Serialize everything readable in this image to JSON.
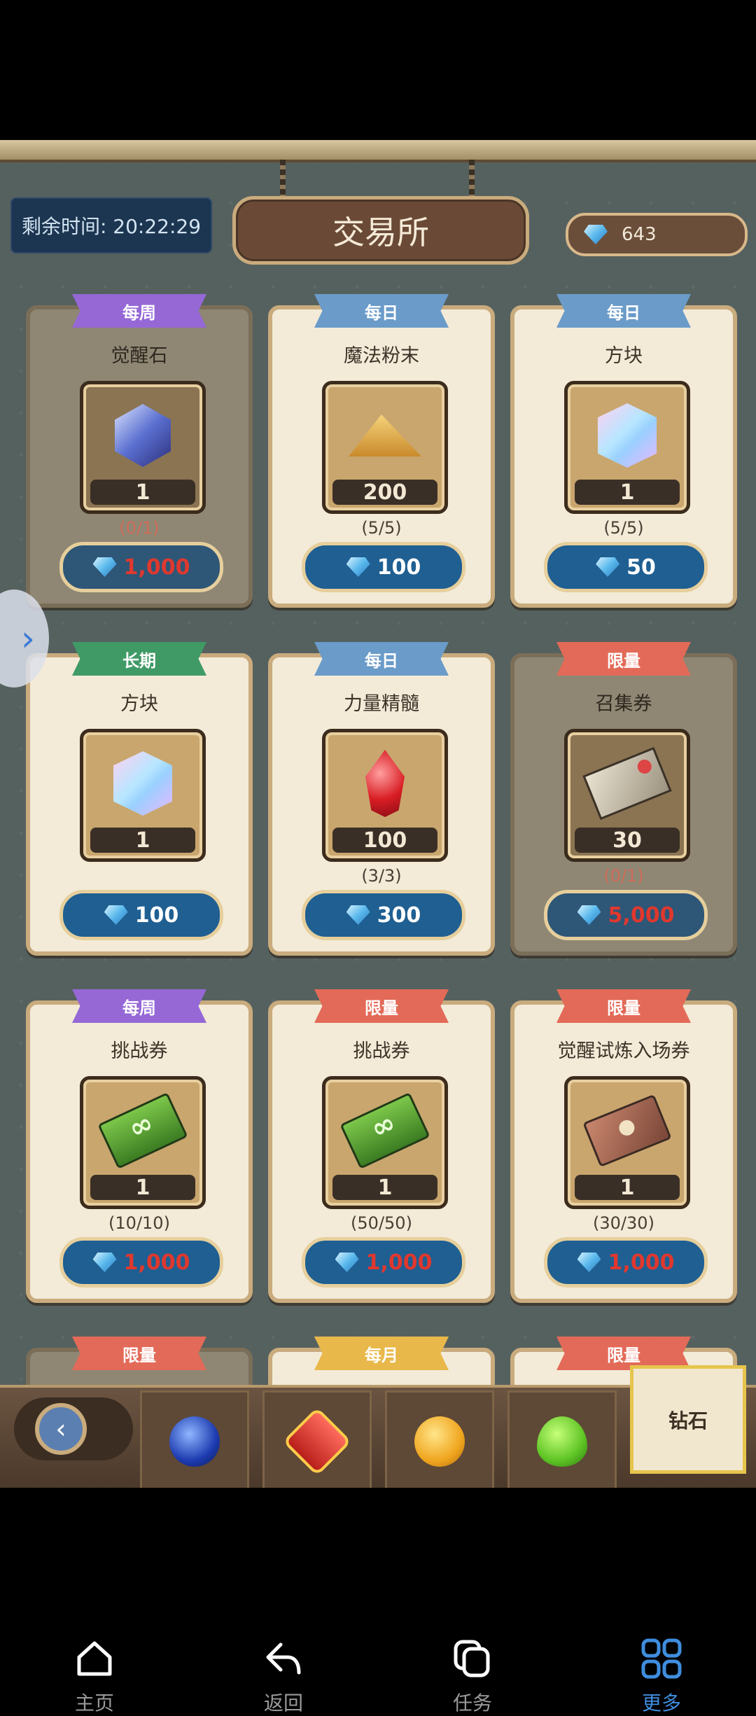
{
  "header": {
    "timer": "剩余时间: 20:22:29",
    "title": "交易所",
    "currency_value": "643"
  },
  "cards": [
    {
      "tag": "每周",
      "tag_color": "#9568d6",
      "name": "觉醒石",
      "icon": "crystal-icon",
      "qty": "1",
      "limit": "(0/1)",
      "price": "1,000",
      "price_red": true,
      "dim": true
    },
    {
      "tag": "每日",
      "tag_color": "#6a9bc9",
      "name": "魔法粉末",
      "icon": "powder-icon",
      "qty": "200",
      "limit": "(5/5)",
      "price": "100",
      "price_red": false,
      "dim": false
    },
    {
      "tag": "每日",
      "tag_color": "#6a9bc9",
      "name": "方块",
      "icon": "cube-icon",
      "qty": "1",
      "limit": "(5/5)",
      "price": "50",
      "price_red": false,
      "dim": false
    },
    {
      "tag": "长期",
      "tag_color": "#3f9a66",
      "name": "方块",
      "icon": "cube-icon",
      "qty": "1",
      "limit": "",
      "price": "100",
      "price_red": false,
      "dim": false
    },
    {
      "tag": "每日",
      "tag_color": "#6a9bc9",
      "name": "力量精髓",
      "icon": "ruby-icon",
      "qty": "100",
      "limit": "(3/3)",
      "price": "300",
      "price_red": false,
      "dim": false
    },
    {
      "tag": "限量",
      "tag_color": "#e36a58",
      "name": "召集券",
      "icon": "summon-ticket-icon",
      "qty": "30",
      "limit": "(0/1)",
      "price": "5,000",
      "price_red": true,
      "dim": true
    },
    {
      "tag": "每周",
      "tag_color": "#9568d6",
      "name": "挑战券",
      "icon": "challenge-ticket-icon",
      "qty": "1",
      "limit": "(10/10)",
      "price": "1,000",
      "price_red": true,
      "dim": false
    },
    {
      "tag": "限量",
      "tag_color": "#e36a58",
      "name": "挑战券",
      "icon": "challenge-ticket-icon",
      "qty": "1",
      "limit": "(50/50)",
      "price": "1,000",
      "price_red": true,
      "dim": false
    },
    {
      "tag": "限量",
      "tag_color": "#e36a58",
      "name": "觉醒试炼入场券",
      "icon": "trial-ticket-icon",
      "qty": "1",
      "limit": "(30/30)",
      "price": "1,000",
      "price_red": true,
      "dim": false
    },
    {
      "tag": "限量",
      "tag_color": "#e36a58",
      "name": "",
      "icon": "",
      "qty": "",
      "limit": "",
      "price": "",
      "price_red": false,
      "dim": true
    },
    {
      "tag": "每月",
      "tag_color": "#e9b84a",
      "name": "",
      "icon": "",
      "qty": "",
      "limit": "",
      "price": "",
      "price_red": false,
      "dim": false
    },
    {
      "tag": "限量",
      "tag_color": "#e36a58",
      "name": "",
      "icon": "",
      "qty": "",
      "limit": "",
      "price": "",
      "price_red": false,
      "dim": false
    }
  ],
  "tabs": {
    "items": [
      "blue-orb-icon",
      "red-badge-icon",
      "gold-coin-icon",
      "green-heart-icon"
    ],
    "active_label": "钻石"
  },
  "nav": [
    {
      "label": "主页",
      "icon": "home-icon"
    },
    {
      "label": "返回",
      "icon": "back-icon"
    },
    {
      "label": "任务",
      "icon": "tasks-icon"
    },
    {
      "label": "更多",
      "icon": "more-icon",
      "active": true
    }
  ]
}
